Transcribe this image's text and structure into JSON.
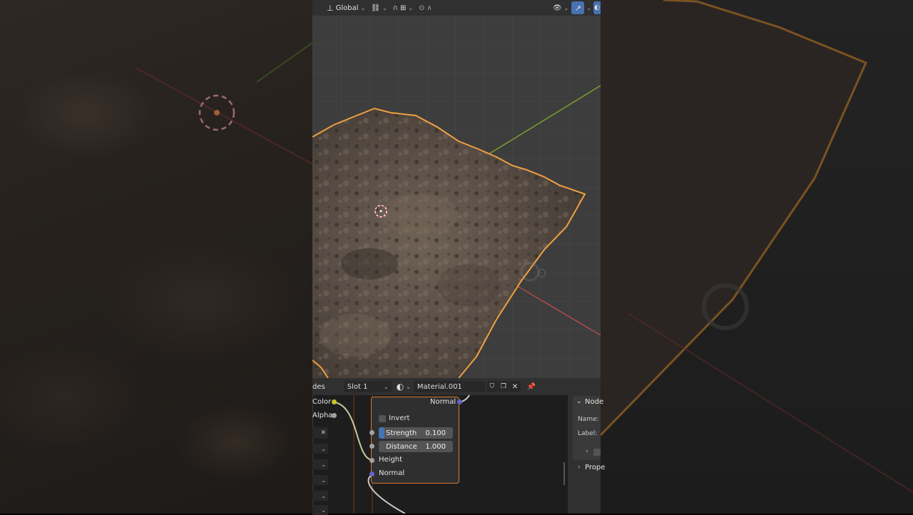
{
  "viewport": {
    "transform_orientation": "Global",
    "watermark_fragment": "o"
  },
  "node_editor": {
    "editor_label_fragment": "des",
    "slot_label": "Slot 1",
    "material_name": "Material.001",
    "left_node": {
      "color_label": "Color",
      "alpha_label": "Alpha"
    },
    "bump_node": {
      "normal_output_label": "Normal",
      "invert_label": "Invert",
      "strength_label": "Strength",
      "strength_value": "0.100",
      "distance_label": "Distance",
      "distance_value": "1.000",
      "height_label": "Height",
      "normal_input_label": "Normal"
    },
    "properties_panel": {
      "node_section": "Node",
      "name_label": "Name:",
      "label_label": "Label:",
      "properties_section": "Prope"
    }
  },
  "colors": {
    "selection_outline": "#f0a040",
    "axis_x": "#c84a4a",
    "axis_y": "#7aa02f",
    "node_selected_border": "#d97b30",
    "active_blue": "#4772b3"
  }
}
